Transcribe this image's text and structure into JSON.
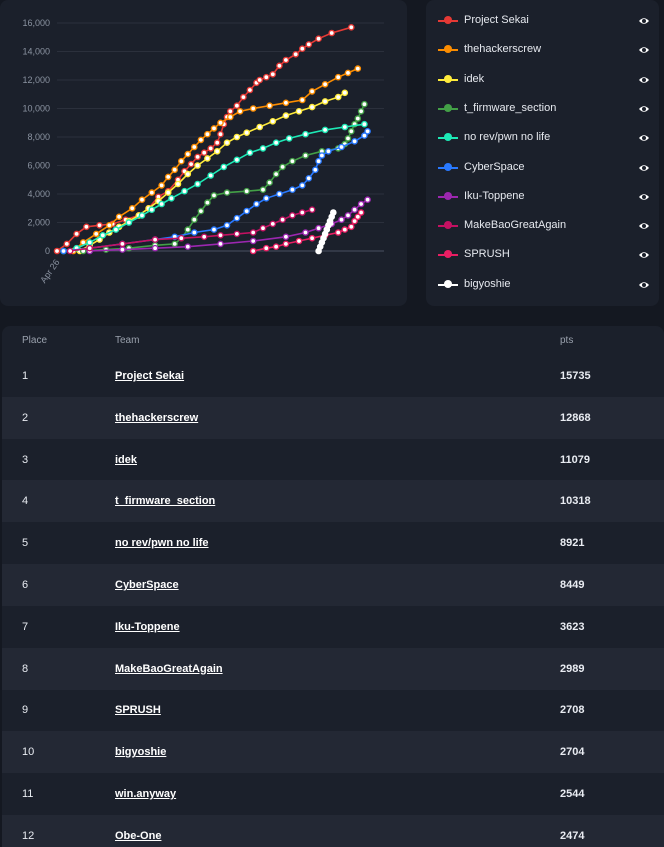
{
  "chart_data": {
    "type": "line",
    "x_axis": {
      "tick_labels": [
        "Apr 26"
      ]
    },
    "y_axis": {
      "min": 0,
      "max": 16000,
      "tick_labels": [
        "0",
        "2,000",
        "4,000",
        "6,000",
        "8,000",
        "10,000",
        "12,000",
        "14,000",
        "16,000"
      ],
      "ticks": [
        0,
        2000,
        4000,
        6000,
        8000,
        10000,
        12000,
        14000,
        16000
      ]
    },
    "x_range": [
      0,
      1
    ],
    "grid": "horizontal",
    "series": [
      {
        "name": "Project Sekai",
        "color": "#e53935",
        "points": [
          [
            0,
            0
          ],
          [
            0.03,
            500
          ],
          [
            0.06,
            1200
          ],
          [
            0.09,
            1700
          ],
          [
            0.13,
            1800
          ],
          [
            0.17,
            1900
          ],
          [
            0.21,
            2200
          ],
          [
            0.25,
            2500
          ],
          [
            0.28,
            3000
          ],
          [
            0.31,
            3800
          ],
          [
            0.34,
            4200
          ],
          [
            0.37,
            5000
          ],
          [
            0.39,
            5600
          ],
          [
            0.41,
            6100
          ],
          [
            0.43,
            6600
          ],
          [
            0.45,
            6900
          ],
          [
            0.47,
            7200
          ],
          [
            0.49,
            7600
          ],
          [
            0.5,
            8200
          ],
          [
            0.51,
            8900
          ],
          [
            0.52,
            9400
          ],
          [
            0.53,
            9800
          ],
          [
            0.55,
            10200
          ],
          [
            0.57,
            10800
          ],
          [
            0.59,
            11300
          ],
          [
            0.61,
            11800
          ],
          [
            0.62,
            12000
          ],
          [
            0.64,
            12200
          ],
          [
            0.66,
            12400
          ],
          [
            0.68,
            13000
          ],
          [
            0.7,
            13400
          ],
          [
            0.73,
            13800
          ],
          [
            0.75,
            14200
          ],
          [
            0.77,
            14500
          ],
          [
            0.8,
            14900
          ],
          [
            0.84,
            15300
          ],
          [
            0.9,
            15700
          ]
        ]
      },
      {
        "name": "thehackerscrew",
        "color": "#fb8c00",
        "points": [
          [
            0.05,
            0
          ],
          [
            0.08,
            600
          ],
          [
            0.12,
            1200
          ],
          [
            0.16,
            1800
          ],
          [
            0.19,
            2400
          ],
          [
            0.23,
            3000
          ],
          [
            0.26,
            3600
          ],
          [
            0.29,
            4100
          ],
          [
            0.32,
            4600
          ],
          [
            0.34,
            5200
          ],
          [
            0.36,
            5700
          ],
          [
            0.38,
            6300
          ],
          [
            0.4,
            6800
          ],
          [
            0.42,
            7300
          ],
          [
            0.44,
            7800
          ],
          [
            0.46,
            8200
          ],
          [
            0.48,
            8600
          ],
          [
            0.5,
            9000
          ],
          [
            0.53,
            9400
          ],
          [
            0.56,
            9800
          ],
          [
            0.6,
            10000
          ],
          [
            0.65,
            10200
          ],
          [
            0.7,
            10400
          ],
          [
            0.75,
            10600
          ],
          [
            0.78,
            11200
          ],
          [
            0.82,
            11700
          ],
          [
            0.86,
            12200
          ],
          [
            0.89,
            12500
          ],
          [
            0.92,
            12800
          ]
        ]
      },
      {
        "name": "idek",
        "color": "#ffeb3b",
        "points": [
          [
            0.07,
            0
          ],
          [
            0.1,
            400
          ],
          [
            0.13,
            800
          ],
          [
            0.16,
            1300
          ],
          [
            0.19,
            1700
          ],
          [
            0.22,
            2100
          ],
          [
            0.25,
            2500
          ],
          [
            0.28,
            3000
          ],
          [
            0.31,
            3500
          ],
          [
            0.34,
            4100
          ],
          [
            0.37,
            4700
          ],
          [
            0.4,
            5400
          ],
          [
            0.43,
            6000
          ],
          [
            0.46,
            6500
          ],
          [
            0.49,
            7000
          ],
          [
            0.52,
            7600
          ],
          [
            0.55,
            8000
          ],
          [
            0.58,
            8300
          ],
          [
            0.62,
            8700
          ],
          [
            0.66,
            9100
          ],
          [
            0.7,
            9500
          ],
          [
            0.74,
            9800
          ],
          [
            0.78,
            10100
          ],
          [
            0.82,
            10500
          ],
          [
            0.86,
            10800
          ],
          [
            0.88,
            11100
          ]
        ]
      },
      {
        "name": "t_firmware_section",
        "color": "#43a047",
        "points": [
          [
            0.08,
            0
          ],
          [
            0.15,
            100
          ],
          [
            0.22,
            200
          ],
          [
            0.3,
            400
          ],
          [
            0.36,
            500
          ],
          [
            0.38,
            900
          ],
          [
            0.4,
            1500
          ],
          [
            0.42,
            2200
          ],
          [
            0.44,
            2800
          ],
          [
            0.46,
            3400
          ],
          [
            0.48,
            3900
          ],
          [
            0.52,
            4100
          ],
          [
            0.58,
            4200
          ],
          [
            0.63,
            4300
          ],
          [
            0.65,
            4800
          ],
          [
            0.67,
            5400
          ],
          [
            0.69,
            5900
          ],
          [
            0.72,
            6300
          ],
          [
            0.76,
            6700
          ],
          [
            0.81,
            7000
          ],
          [
            0.86,
            7200
          ],
          [
            0.88,
            7500
          ],
          [
            0.89,
            7900
          ],
          [
            0.9,
            8400
          ],
          [
            0.91,
            8900
          ],
          [
            0.92,
            9300
          ],
          [
            0.93,
            9800
          ],
          [
            0.94,
            10300
          ]
        ]
      },
      {
        "name": "no rev/pwn no life",
        "color": "#1de9b6",
        "points": [
          [
            0.02,
            0
          ],
          [
            0.06,
            200
          ],
          [
            0.1,
            600
          ],
          [
            0.14,
            1100
          ],
          [
            0.18,
            1500
          ],
          [
            0.22,
            2000
          ],
          [
            0.26,
            2500
          ],
          [
            0.29,
            2900
          ],
          [
            0.32,
            3300
          ],
          [
            0.35,
            3700
          ],
          [
            0.39,
            4200
          ],
          [
            0.43,
            4700
          ],
          [
            0.47,
            5300
          ],
          [
            0.51,
            5900
          ],
          [
            0.55,
            6400
          ],
          [
            0.59,
            6900
          ],
          [
            0.63,
            7200
          ],
          [
            0.67,
            7600
          ],
          [
            0.71,
            7900
          ],
          [
            0.76,
            8200
          ],
          [
            0.82,
            8500
          ],
          [
            0.88,
            8700
          ],
          [
            0.94,
            8900
          ]
        ]
      },
      {
        "name": "CyberSpace",
        "color": "#2979ff",
        "points": [
          [
            0.02,
            0
          ],
          [
            0.1,
            200
          ],
          [
            0.2,
            500
          ],
          [
            0.3,
            800
          ],
          [
            0.36,
            1000
          ],
          [
            0.42,
            1300
          ],
          [
            0.48,
            1500
          ],
          [
            0.52,
            1800
          ],
          [
            0.55,
            2300
          ],
          [
            0.58,
            2800
          ],
          [
            0.61,
            3300
          ],
          [
            0.64,
            3700
          ],
          [
            0.68,
            4000
          ],
          [
            0.72,
            4300
          ],
          [
            0.75,
            4600
          ],
          [
            0.77,
            5100
          ],
          [
            0.79,
            5700
          ],
          [
            0.8,
            6300
          ],
          [
            0.81,
            6700
          ],
          [
            0.83,
            7000
          ],
          [
            0.87,
            7300
          ],
          [
            0.91,
            7700
          ],
          [
            0.94,
            8100
          ],
          [
            0.95,
            8400
          ]
        ]
      },
      {
        "name": "Iku-Toppene",
        "color": "#9c27b0",
        "points": [
          [
            0.1,
            0
          ],
          [
            0.2,
            100
          ],
          [
            0.3,
            200
          ],
          [
            0.4,
            300
          ],
          [
            0.5,
            500
          ],
          [
            0.6,
            700
          ],
          [
            0.7,
            1000
          ],
          [
            0.76,
            1300
          ],
          [
            0.8,
            1600
          ],
          [
            0.84,
            1900
          ],
          [
            0.87,
            2200
          ],
          [
            0.89,
            2500
          ],
          [
            0.91,
            2900
          ],
          [
            0.93,
            3300
          ],
          [
            0.95,
            3600
          ]
        ]
      },
      {
        "name": "MakeBaoGreatAgain",
        "color": "#c51162",
        "points": [
          [
            0.04,
            0
          ],
          [
            0.1,
            200
          ],
          [
            0.2,
            500
          ],
          [
            0.3,
            800
          ],
          [
            0.38,
            900
          ],
          [
            0.45,
            1000
          ],
          [
            0.5,
            1100
          ],
          [
            0.55,
            1200
          ],
          [
            0.6,
            1300
          ],
          [
            0.63,
            1600
          ],
          [
            0.66,
            1900
          ],
          [
            0.69,
            2200
          ],
          [
            0.72,
            2500
          ],
          [
            0.75,
            2700
          ],
          [
            0.78,
            2900
          ]
        ]
      },
      {
        "name": "SPRUSH",
        "color": "#e91e63",
        "points": [
          [
            0.6,
            0
          ],
          [
            0.64,
            200
          ],
          [
            0.67,
            300
          ],
          [
            0.7,
            500
          ],
          [
            0.74,
            700
          ],
          [
            0.78,
            900
          ],
          [
            0.82,
            1100
          ],
          [
            0.86,
            1300
          ],
          [
            0.88,
            1500
          ],
          [
            0.9,
            1700
          ],
          [
            0.91,
            2100
          ],
          [
            0.92,
            2400
          ],
          [
            0.93,
            2700
          ]
        ]
      },
      {
        "name": "bigyoshie",
        "color": "#ffffff",
        "points": [
          [
            0.8,
            0
          ],
          [
            0.805,
            300
          ],
          [
            0.81,
            600
          ],
          [
            0.815,
            900
          ],
          [
            0.82,
            1200
          ],
          [
            0.825,
            1500
          ],
          [
            0.83,
            1800
          ],
          [
            0.835,
            2100
          ],
          [
            0.84,
            2400
          ],
          [
            0.845,
            2700
          ]
        ]
      }
    ]
  },
  "legend": {
    "items": [
      {
        "label": "Project Sekai",
        "color": "#e53935"
      },
      {
        "label": "thehackerscrew",
        "color": "#fb8c00"
      },
      {
        "label": "idek",
        "color": "#ffeb3b"
      },
      {
        "label": "t_firmware_section",
        "color": "#43a047"
      },
      {
        "label": "no rev/pwn no life",
        "color": "#1de9b6"
      },
      {
        "label": "CyberSpace",
        "color": "#2979ff"
      },
      {
        "label": "Iku-Toppene",
        "color": "#9c27b0"
      },
      {
        "label": "MakeBaoGreatAgain",
        "color": "#c51162"
      },
      {
        "label": "SPRUSH",
        "color": "#e91e63"
      },
      {
        "label": "bigyoshie",
        "color": "#ffffff"
      }
    ],
    "toggle_icon": "eye-icon"
  },
  "scoreboard": {
    "headers": {
      "place": "Place",
      "team": "Team",
      "pts": "pts"
    },
    "rows": [
      {
        "place": "1",
        "team": "Project Sekai",
        "pts": "15735"
      },
      {
        "place": "2",
        "team": "thehackerscrew",
        "pts": "12868"
      },
      {
        "place": "3",
        "team": "idek",
        "pts": "11079"
      },
      {
        "place": "4",
        "team": "t_firmware_section",
        "pts": "10318"
      },
      {
        "place": "5",
        "team": "no rev/pwn no life",
        "pts": "8921"
      },
      {
        "place": "6",
        "team": "CyberSpace",
        "pts": "8449"
      },
      {
        "place": "7",
        "team": "Iku-Toppene",
        "pts": "3623"
      },
      {
        "place": "8",
        "team": "MakeBaoGreatAgain",
        "pts": "2989"
      },
      {
        "place": "9",
        "team": "SPRUSH",
        "pts": "2708"
      },
      {
        "place": "10",
        "team": "bigyoshie",
        "pts": "2704"
      },
      {
        "place": "11",
        "team": "win.anyway",
        "pts": "2544"
      },
      {
        "place": "12",
        "team": "Obe-One",
        "pts": "2474"
      }
    ]
  }
}
